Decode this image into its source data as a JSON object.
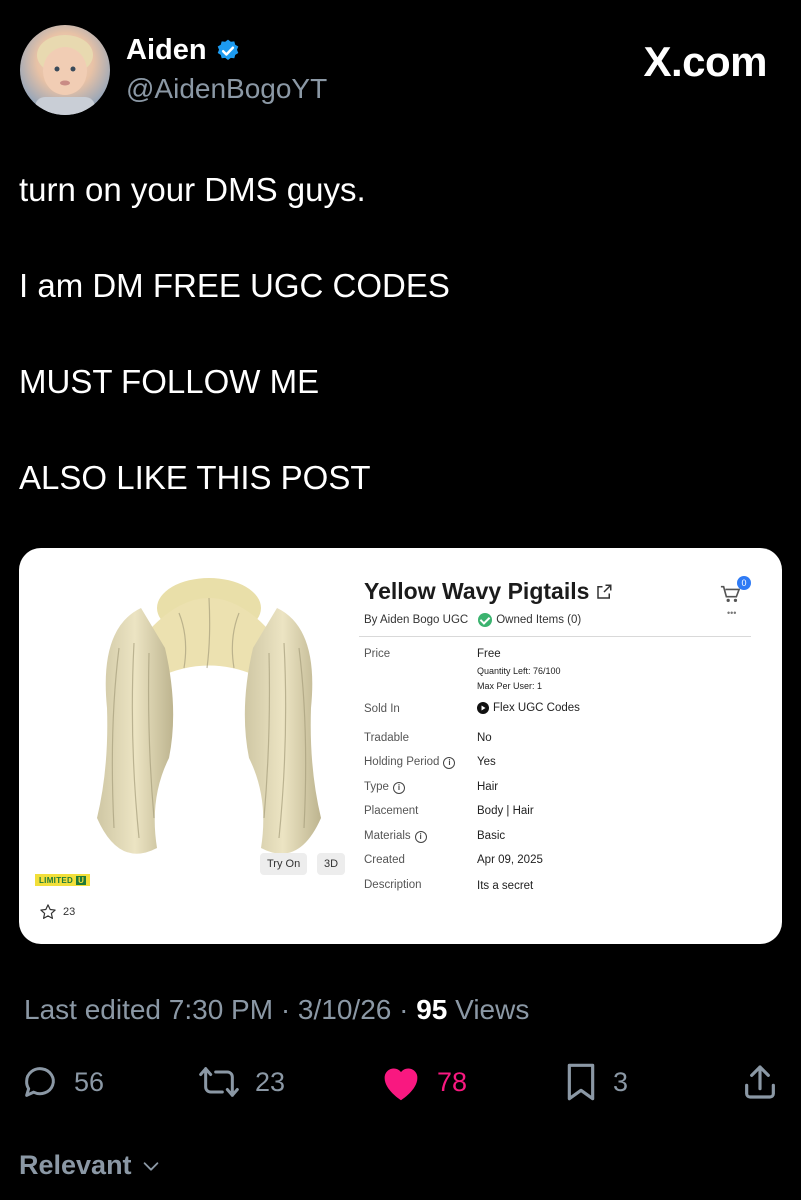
{
  "author": {
    "name": "Aiden",
    "handle": "@AidenBogoYT",
    "verified_color": "#1d9bf0"
  },
  "brand": "X.com",
  "post": {
    "lines": [
      "turn on your DMS guys.",
      "I am DM FREE UGC CODES",
      "MUST FOLLOW ME",
      "ALSO LIKE THIS POST"
    ]
  },
  "card": {
    "title": "Yellow Wavy Pigtails",
    "by": "By Aiden Bogo UGC",
    "owned": "Owned Items (0)",
    "cart_count": "0",
    "more": "•••",
    "rows": {
      "price_label": "Price",
      "price_value": "Free",
      "quantity_left": "Quantity Left: 76/100",
      "max_per_user": "Max Per User: 1",
      "sold_in_label": "Sold In",
      "sold_in_value": "Flex UGC Codes",
      "tradable_label": "Tradable",
      "tradable_value": "No",
      "holding_label": "Holding Period",
      "holding_value": "Yes",
      "type_label": "Type",
      "type_value": "Hair",
      "placement_label": "Placement",
      "placement_value": "Body | Hair",
      "materials_label": "Materials",
      "materials_value": "Basic",
      "created_label": "Created",
      "created_value": "Apr 09, 2025",
      "description_label": "Description",
      "description_value": "Its a secret"
    },
    "try_on": "Try On",
    "three_d": "3D",
    "limited": "LIMITED",
    "limited_u": "U",
    "favorites": "23"
  },
  "meta": {
    "edited": "Last edited 7:30 PM · 3/10/26 · ",
    "views_count": "95",
    "views_label": " Views"
  },
  "actions": {
    "replies": "56",
    "reposts": "23",
    "likes": "78",
    "bookmarks": "3",
    "like_color": "#f91880"
  },
  "sort": {
    "label": "Relevant"
  }
}
